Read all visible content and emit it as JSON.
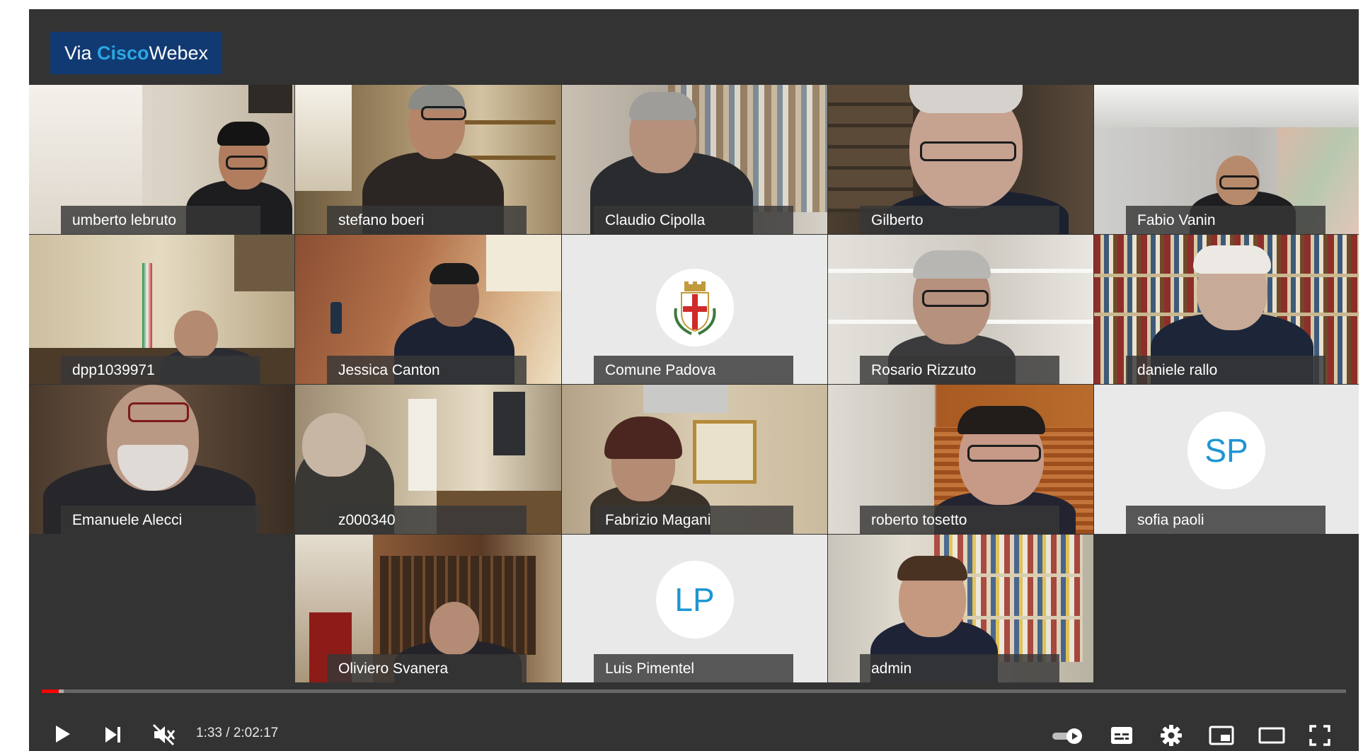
{
  "badge": {
    "prefix": "Via ",
    "brand": "Cisco",
    "product": "Webex"
  },
  "participants": [
    {
      "name": "umberto lebruto"
    },
    {
      "name": "stefano boeri"
    },
    {
      "name": "Claudio Cipolla"
    },
    {
      "name": "Gilberto"
    },
    {
      "name": "Fabio Vanin"
    },
    {
      "name": "dpp1039971"
    },
    {
      "name": "Jessica Canton"
    },
    {
      "name": "Comune Padova"
    },
    {
      "name": "Rosario Rizzuto"
    },
    {
      "name": "daniele rallo"
    },
    {
      "name": "Emanuele Alecci"
    },
    {
      "name": "z000340"
    },
    {
      "name": "Fabrizio Magani"
    },
    {
      "name": "roberto tosetto"
    },
    {
      "name": "sofia paoli",
      "initials": "SP"
    },
    {
      "name": "Oliviero Svanera"
    },
    {
      "name": "Luis Pimentel",
      "initials": "LP"
    },
    {
      "name": "admin"
    }
  ],
  "controls": {
    "time": "1:33 / 2:02:17",
    "played_fraction": 0.013,
    "buffered_fraction": 0.017,
    "icons": [
      "play-icon",
      "next-icon",
      "muted-volume-icon",
      "autoplay-toggle-icon",
      "subtitles-icon",
      "settings-icon",
      "miniplayer-icon",
      "theater-mode-icon",
      "fullscreen-icon"
    ]
  },
  "colors": {
    "progress": "#ff0000",
    "badge_bg": "#123a72",
    "badge_brand": "#2aa7e3",
    "avatar_text": "#1e95d4"
  }
}
